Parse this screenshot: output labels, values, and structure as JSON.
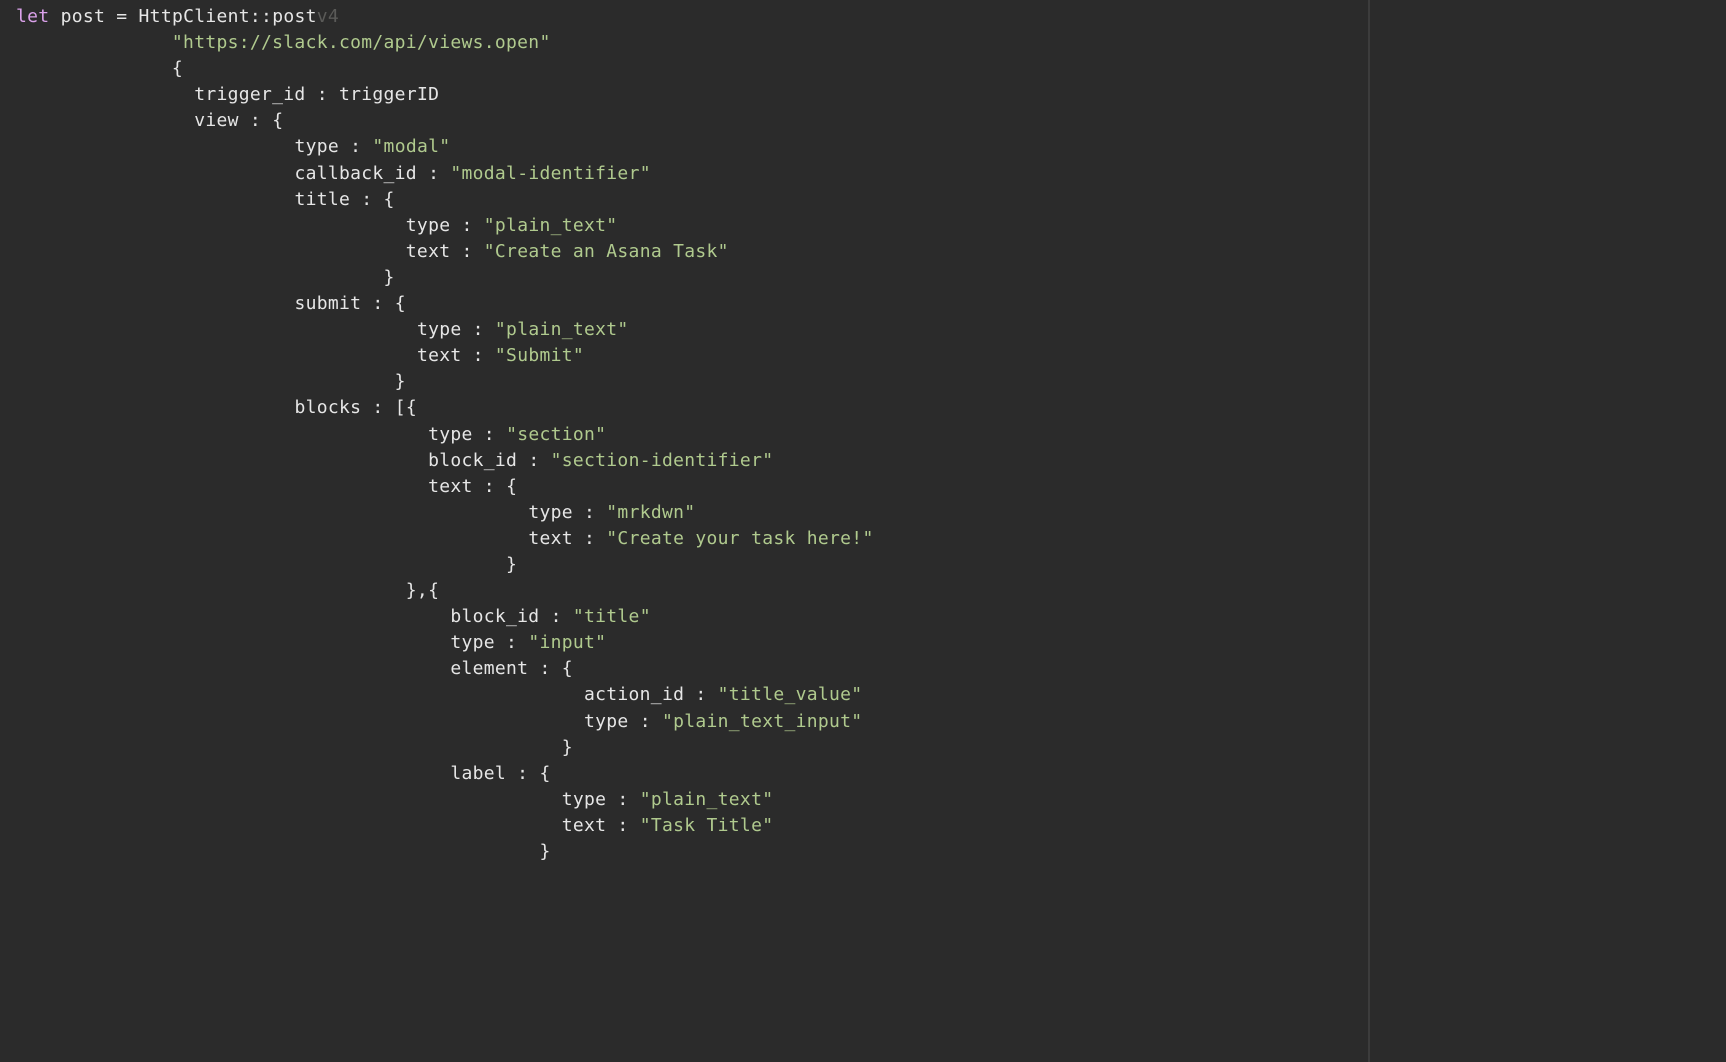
{
  "code": {
    "let": "let",
    "postVar": "post",
    "eq": "=",
    "httpClient": "HttpClient",
    "doubleColon": "::",
    "postMethod": "post",
    "ghostSuffix": "v4",
    "url": "\"https://slack.com/api/views.open\"",
    "openBrace1": "{",
    "triggerKey": "trigger_id",
    "colon": ":",
    "triggerVal": "triggerID",
    "viewKey": "view",
    "openBrace2": "{",
    "typeKey": "type",
    "modalStr": "\"modal\"",
    "callbackKey": "callback_id",
    "callbackStr": "\"modal-identifier\"",
    "titleKey": "title",
    "openBrace3": "{",
    "plainTextStr": "\"plain_text\"",
    "textKey": "text",
    "titleTextStr": "\"Create an Asana Task\"",
    "closeBrace1": "}",
    "submitKey": "submit",
    "openBrace4": "{",
    "submitTextStr": "\"Submit\"",
    "closeBrace2": "}",
    "blocksKey": "blocks",
    "openBracket": "[{",
    "sectionStr": "\"section\"",
    "blockIdKey": "block_id",
    "sectionIdStr": "\"section-identifier\"",
    "openBrace5": "{",
    "mrkdwnStr": "\"mrkdwn\"",
    "createTaskStr": "\"Create your task here!\"",
    "closeBrace3": "}",
    "closeOpenBrace": "},{",
    "titleStr": "\"title\"",
    "inputStr": "\"input\"",
    "elementKey": "element",
    "openBrace6": "{",
    "actionIdKey": "action_id",
    "titleValueStr": "\"title_value\"",
    "plainTextInputStr": "\"plain_text_input\"",
    "closeBrace4": "}",
    "labelKey": "label",
    "openBrace7": "{",
    "taskTitleStr": "\"Task Title\"",
    "closeBrace5": "}"
  }
}
